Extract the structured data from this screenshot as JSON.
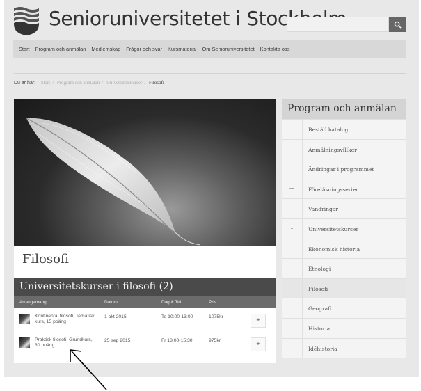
{
  "header": {
    "site_title": "Senioruniversitetet i Stockholm",
    "search_placeholder": ""
  },
  "nav": {
    "items": [
      "Start",
      "Program och anmälan",
      "Medlemskap",
      "Frågor och svar",
      "Kursmaterial",
      "Om Senioruniversitetet",
      "Kontakta oss"
    ]
  },
  "breadcrumb": {
    "label": "Du är här:",
    "items": [
      "Start",
      "Program och anmälan",
      "Universitetskurser"
    ],
    "current": "Filosofi"
  },
  "page": {
    "heading": "Filosofi"
  },
  "courses": {
    "title": "Universitetskurser i filosofi (2)",
    "columns": [
      "Arrangemang",
      "Datum",
      "Dag & Tid",
      "Pris"
    ],
    "rows": [
      {
        "name": "Kontinental filosofi, Tematisk kurs, 15 poäng",
        "date": "1 okt 2015",
        "time": "To 10:00-13:00",
        "price": "1075kr",
        "add": "+"
      },
      {
        "name": "Praktisk filosofi, Grundkurs, 30 poäng",
        "date": "25 sep 2015",
        "time": "Fr 13:00-15:30",
        "price": "975kr",
        "add": "+"
      }
    ]
  },
  "sidebar": {
    "title": "Program och anmälan",
    "items": [
      {
        "mark": "",
        "label": "Beställ katalog"
      },
      {
        "mark": "",
        "label": "Anmälningsvillkor"
      },
      {
        "mark": "",
        "label": "Ändringar i programmet"
      },
      {
        "mark": "+",
        "label": "Föreläsningsserier"
      },
      {
        "mark": "",
        "label": "Vandringar"
      },
      {
        "mark": "-",
        "label": "Universitetskurser"
      },
      {
        "mark": "",
        "label": "Ekonomisk historia"
      },
      {
        "mark": "",
        "label": "Etnologi"
      },
      {
        "mark": "",
        "label": "Filosofi"
      },
      {
        "mark": "",
        "label": "Geografi"
      },
      {
        "mark": "",
        "label": "Historia"
      },
      {
        "mark": "",
        "label": "Idéhistoria"
      }
    ],
    "active_index": 8
  },
  "colors": {
    "header_bar": "#4a4a4a",
    "nav_bg": "#d8d8d8",
    "sidebar_title_bg": "#d4d4d4"
  },
  "icons": [
    "shield-logo-icon",
    "search-icon",
    "feather-image",
    "arrow-annotation"
  ]
}
